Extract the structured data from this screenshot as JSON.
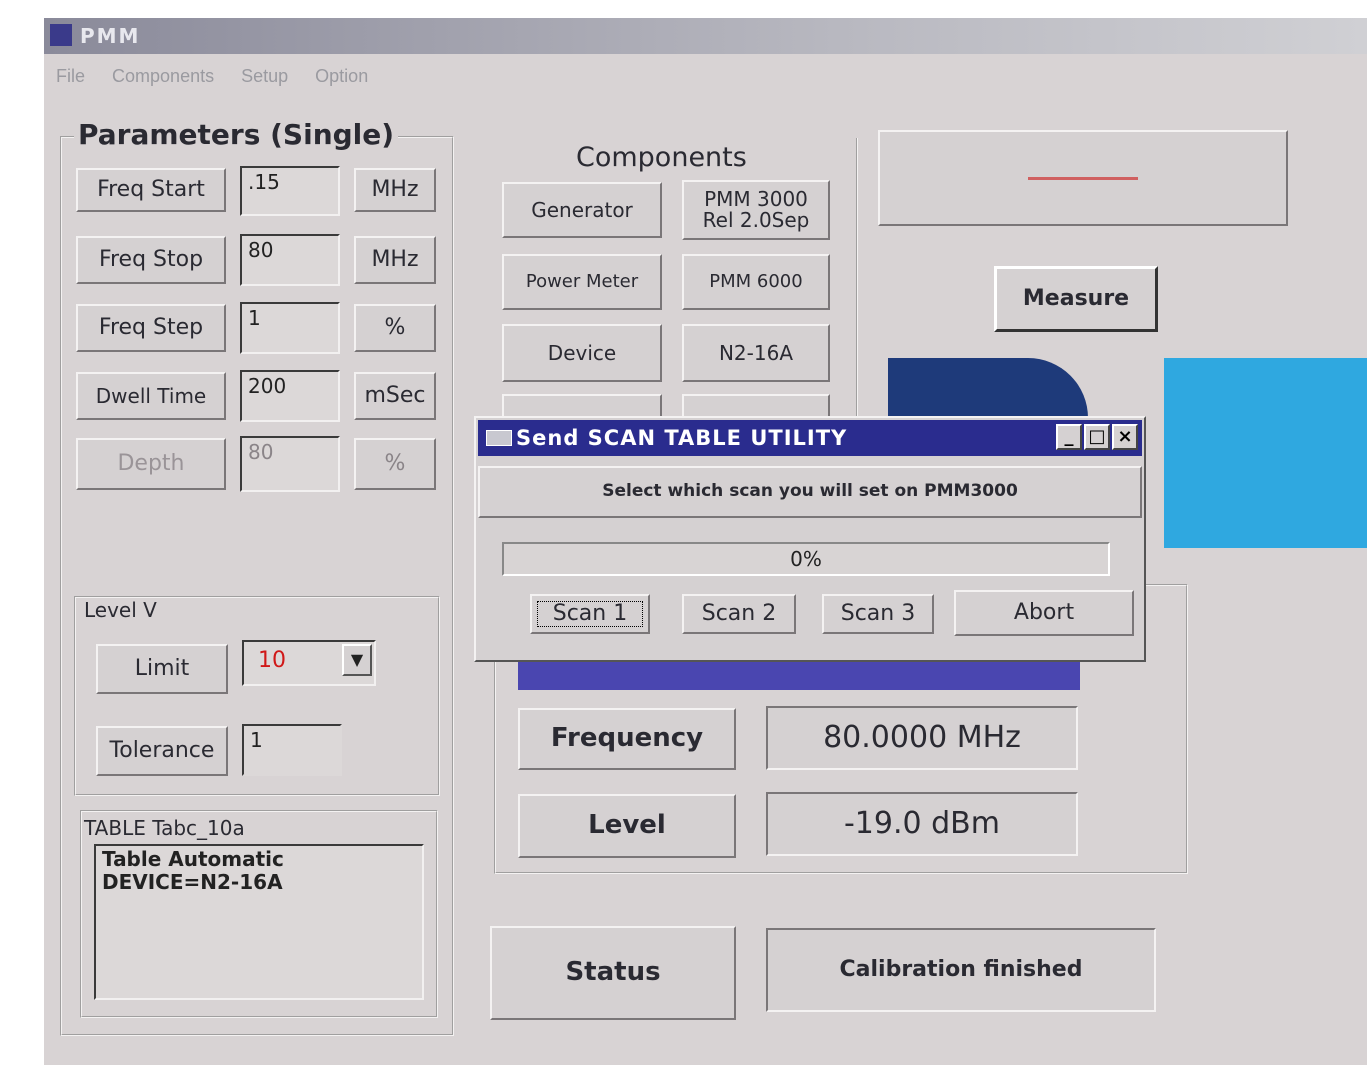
{
  "window": {
    "title": "PMM",
    "menu": [
      "File",
      "Components",
      "Setup",
      "Option"
    ]
  },
  "parameters": {
    "title": "Parameters (Single)",
    "rows": [
      {
        "label": "Freq Start",
        "value": ".15",
        "unit": "MHz"
      },
      {
        "label": "Freq Stop",
        "value": "80",
        "unit": "MHz"
      },
      {
        "label": "Freq Step",
        "value": "1",
        "unit": "%"
      },
      {
        "label": "Dwell Time",
        "value": "200",
        "unit": "mSec"
      },
      {
        "label": "Depth",
        "value": "80",
        "unit": "%"
      }
    ],
    "level_group": "Level V",
    "limit_label": "Limit",
    "limit_value": "10",
    "tolerance_label": "Tolerance",
    "tolerance_value": "1",
    "table_title": "TABLE Tabc_10a",
    "table_lines": [
      "Table Automatic",
      "DEVICE=N2-16A"
    ]
  },
  "components": {
    "title": "Components",
    "rows": [
      {
        "label": "Generator",
        "value": "PMM 3000 Rel 2.0Sep"
      },
      {
        "label": "Power Meter",
        "value": "PMM 6000"
      },
      {
        "label": "Device",
        "value": "N2-16A"
      }
    ]
  },
  "measure_button": "Measure",
  "readouts": {
    "frequency_label": "Frequency",
    "frequency_value": "80.0000 MHz",
    "level_label": "Level",
    "level_value": "-19.0 dBm"
  },
  "status": {
    "label": "Status",
    "value": "Calibration finished"
  },
  "dialog": {
    "title": "Send SCAN TABLE UTILITY",
    "message": "Select which scan you will set on PMM3000",
    "progress": "0%",
    "buttons": [
      "Scan 1",
      "Scan 2",
      "Scan 3",
      "Abort"
    ]
  },
  "colors": {
    "dialog_title_bg": "#2a2c8e",
    "limit_value_color": "#d01818",
    "logo_blue": "#2fa8e0",
    "logo_navy": "#1e3a7a"
  }
}
